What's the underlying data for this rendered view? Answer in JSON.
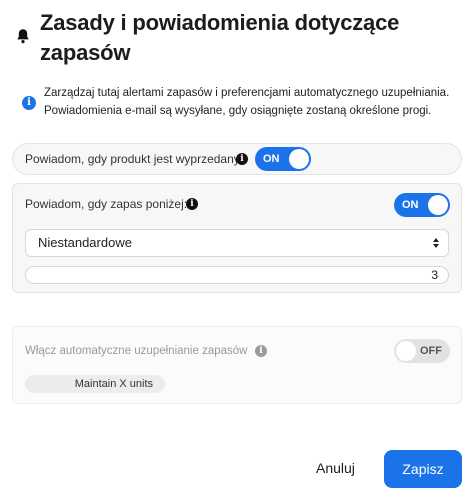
{
  "dialog": {
    "title": "Zasady i powiadomienia dotyczące zapasów",
    "info_text": "Zarządzaj tutaj alertami zapasów i preferencjami automatycznego uzupełniania. Powiadomienia e-mail są wysyłane, gdy osiągnięte zostaną określone progi."
  },
  "out_of_stock": {
    "label": "Powiadom, gdy produkt jest wyprzedany",
    "toggle_label": "ON",
    "enabled": true
  },
  "low_stock": {
    "label": "Powiadom, gdy zapas poniżej:",
    "toggle_label": "ON",
    "enabled": true,
    "select_value": "Niestandardowe",
    "threshold_value": "3"
  },
  "auto_restock": {
    "label": "Włącz automatyczne uzupełnianie zapasów",
    "toggle_label": "OFF",
    "enabled": false,
    "mode_label": "Maintain X units"
  },
  "actions": {
    "cancel_label": "Anuluj",
    "save_label": "Zapisz"
  },
  "colors": {
    "accent": "#1a73e8",
    "panel_bg": "#f7f7f7",
    "disabled_text": "#9a9a9a"
  },
  "icons": {
    "header": "bell-icon",
    "info": "info-icon",
    "help": "help-icon",
    "select": "chevron-updown-icon"
  }
}
